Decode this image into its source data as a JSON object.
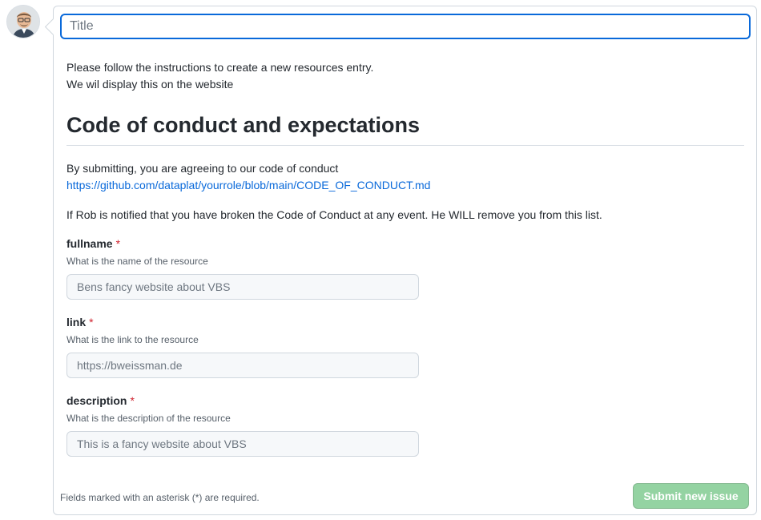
{
  "title_field": {
    "placeholder": "Title",
    "value": ""
  },
  "intro": {
    "line1": "Please follow the instructions to create a new resources entry.",
    "line2": "We wil display this on the website"
  },
  "section": {
    "heading": "Code of conduct and expectations",
    "agree_text": "By submitting, you are agreeing to our code of conduct",
    "coc_link": "https://github.com/dataplat/yourrole/blob/main/CODE_OF_CONDUCT.md",
    "warning": "If Rob is notified that you have broken the Code of Conduct at any event. He WILL remove you from this list."
  },
  "fields": [
    {
      "label": "fullname",
      "required": "*",
      "description": "What is the name of the resource",
      "placeholder": "Bens fancy website about VBS"
    },
    {
      "label": "link",
      "required": "*",
      "description": "What is the link to the resource",
      "placeholder": "https://bweissman.de"
    },
    {
      "label": "description",
      "required": "*",
      "description": "What is the description of the resource",
      "placeholder": "This is a fancy website about VBS"
    }
  ],
  "footer": {
    "note": "Fields marked with an asterisk (*) are required.",
    "submit_label": "Submit new issue"
  },
  "colors": {
    "accent": "#0969da",
    "required": "#cf222e",
    "submit_disabled": "#94d3a2"
  }
}
